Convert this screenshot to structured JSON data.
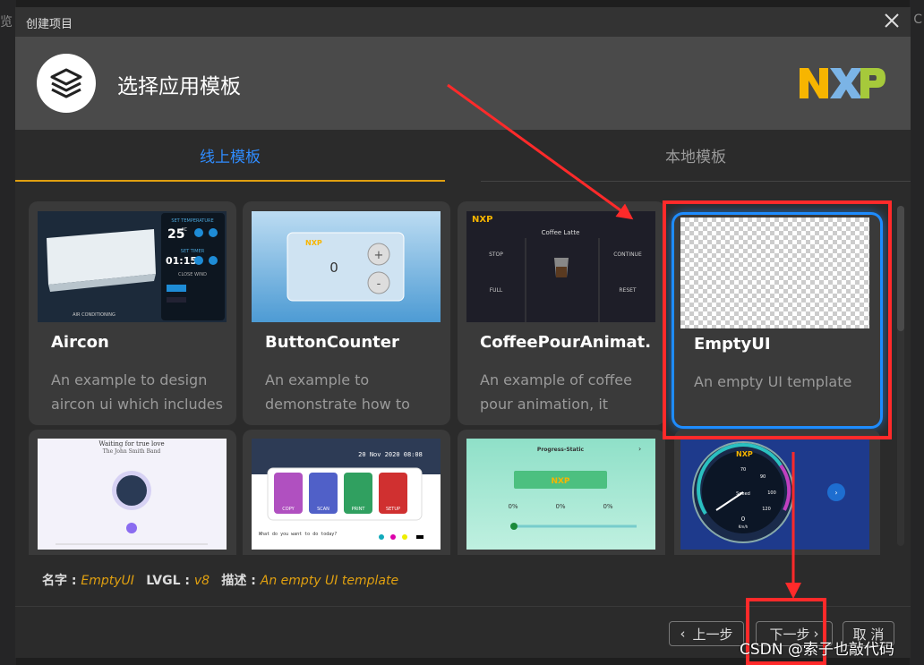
{
  "background": {
    "left_char": "览",
    "right_char": "C"
  },
  "dialog": {
    "title": "创建项目",
    "heading": "选择应用模板",
    "brand_logo_text": "NXP"
  },
  "tabs": [
    {
      "label": "线上模板",
      "active": true
    },
    {
      "label": "本地模板",
      "active": false
    }
  ],
  "templates": [
    {
      "name": "Aircon",
      "desc_line1": "An example to design",
      "desc_line2": "aircon ui which includes"
    },
    {
      "name": "ButtonCounter",
      "desc_line1": "An example to",
      "desc_line2": "demonstrate how to"
    },
    {
      "name": "CoffeePourAnimat...",
      "desc_line1": "An example of coffee",
      "desc_line2": "pour animation, it"
    },
    {
      "name": "EmptyUI",
      "desc_line1": "An empty UI template",
      "desc_line2": "",
      "selected": true
    }
  ],
  "thumbs": {
    "aircon": {
      "set_temp": "SET TEMPERATURE",
      "temp": "25",
      "temp_unit": "°C",
      "set_timer": "SET TIMER",
      "timer": "01:15",
      "wind": "CLOSE WIND",
      "caption": "AIR CONDITIONING"
    },
    "counter": {
      "logo": "NXP",
      "value": "0",
      "plus": "+",
      "minus": "-"
    },
    "coffee": {
      "logo": "NXP",
      "title": "Coffee Latte",
      "stop": "STOP",
      "full": "FULL",
      "continue": "CONTINUE",
      "reset": "RESET"
    },
    "music": {
      "title": "Waiting for true love",
      "artist": "The John Smith Band"
    },
    "scan": {
      "date": "20 Nov 2020 08:08",
      "labels": [
        "COPY",
        "SCAN",
        "PRINT",
        "SETUP"
      ],
      "question": "What do you want to do today?"
    },
    "progress": {
      "title": "Progress-Static",
      "pct": [
        "0%",
        "0%",
        "0%"
      ],
      "logo": "NXP"
    },
    "speed": {
      "logo": "NXP",
      "ticks": [
        "10",
        "20",
        "30",
        "40",
        "50",
        "60",
        "70",
        "80",
        "90",
        "100",
        "110",
        "120"
      ],
      "label": "Speed",
      "value": "0",
      "unit": "Km/h"
    }
  },
  "info": {
    "name_key": "名字 : ",
    "name_val": "EmptyUI",
    "lvgl_key": "LVGL : ",
    "lvgl_val": "v8",
    "desc_key": "描述 : ",
    "desc_val": "An empty UI template"
  },
  "buttons": {
    "prev": "上一步",
    "next": "下一步",
    "cancel": "取 消"
  },
  "watermark": "CSDN @索子也敲代码",
  "colors": {
    "accent_blue": "#2f8cff",
    "accent_orange": "#e0a010",
    "highlight_red": "#ff2a2a"
  }
}
